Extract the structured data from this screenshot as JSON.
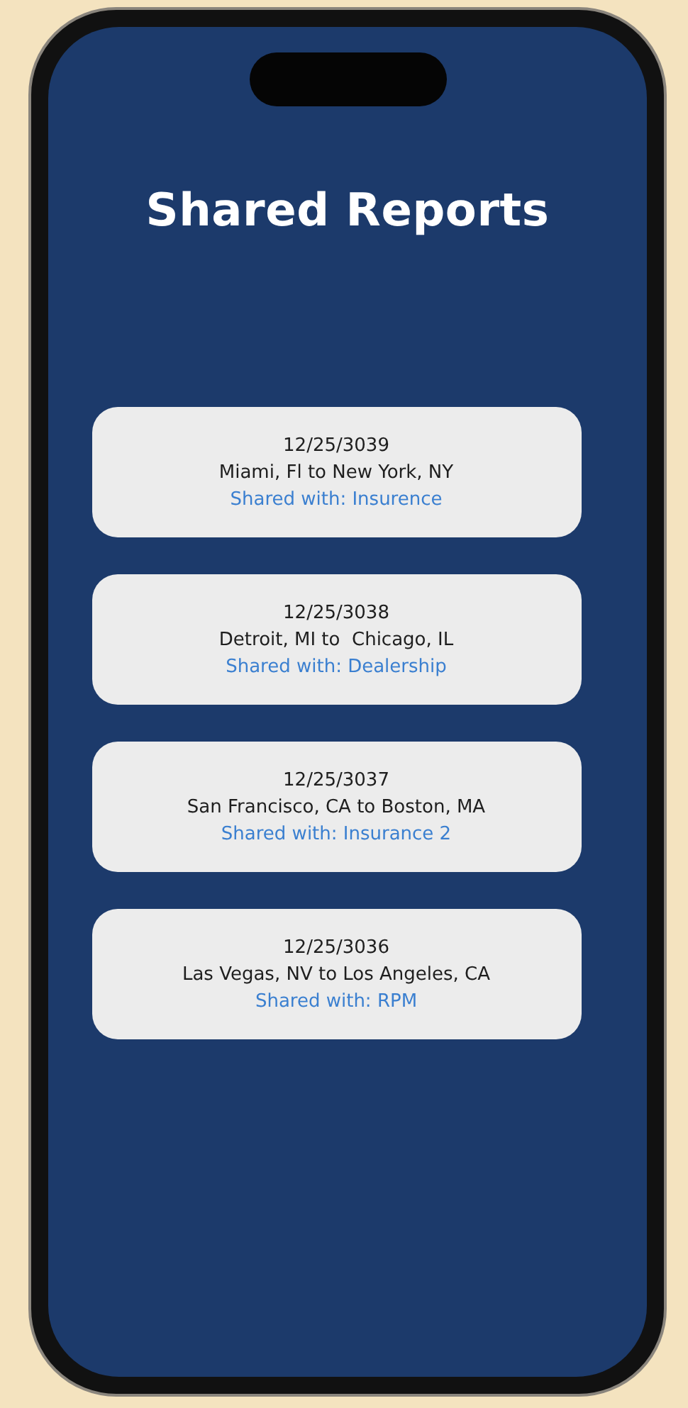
{
  "title": "Shared Reports",
  "reports": [
    {
      "date": "12/25/3039",
      "route": "Miami, Fl to New York, NY",
      "shared": "Shared with: Insurence"
    },
    {
      "date": "12/25/3038",
      "route": "Detroit, MI to  Chicago, IL",
      "shared": "Shared with: Dealership"
    },
    {
      "date": "12/25/3037",
      "route": "San Francisco, CA to Boston, MA",
      "shared": "Shared with: Insurance 2"
    },
    {
      "date": "12/25/3036",
      "route": "Las Vegas, NV to Los Angeles, CA",
      "shared": "Shared with: RPM"
    }
  ]
}
